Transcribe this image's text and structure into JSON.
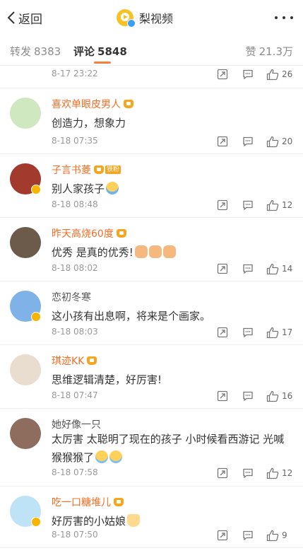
{
  "nav": {
    "back_label": "返回",
    "title": "梨视频",
    "logo_color": "#f6c224",
    "more_icon": "more-dots-icon"
  },
  "tabs": {
    "repost_label": "转发",
    "repost_count": "8383",
    "comment_label": "评论",
    "comment_count": "5848",
    "like_label": "赞",
    "like_count": "21.3万",
    "accent_color": "#fa7d3c"
  },
  "comments": [
    {
      "time": "8-17 23:22",
      "likes": "26"
    },
    {
      "name": "喜欢单眼皮男人",
      "vip": true,
      "verified": false,
      "text": "创造力，想象力",
      "emoji": [],
      "time": "8-18 07:35",
      "likes": "20",
      "avatar_color": "#cfe8c0"
    },
    {
      "name": "子言书菱",
      "vip": true,
      "fan_tag": "铁粉",
      "verified": true,
      "text": "别人家孩子",
      "emoji": [
        "cry"
      ],
      "time": "8-18 08:48",
      "likes": "12",
      "avatar_color": "#a33a2e"
    },
    {
      "name": "昨天高烧60度",
      "vip": true,
      "verified": false,
      "text": "优秀 是真的优秀!",
      "emoji": [
        "clap",
        "clap",
        "clap"
      ],
      "time": "8-18 08:02",
      "likes": "14",
      "avatar_color": "#6c5a4a"
    },
    {
      "name": "恋初冬寒",
      "vip": false,
      "verified": true,
      "text": "这小孩有出息啊，将来是个画家。",
      "emoji": [],
      "time": "8-18 08:03",
      "likes": "17",
      "avatar_color": "#7fb3e8"
    },
    {
      "name": "琪迹KK",
      "vip": true,
      "verified": false,
      "text": "思维逻辑清楚，好厉害!",
      "emoji": [],
      "time": "8-18 07:47",
      "likes": "16",
      "avatar_color": "#e9ddd0"
    },
    {
      "name": "她好像一只",
      "vip": false,
      "verified": false,
      "text": "太厉害 太聪明了现在的孩子 小时候看西游记 光喊猴猴猴了",
      "emoji": [
        "laugh",
        "laugh"
      ],
      "time": "8-18 07:58",
      "likes": "12",
      "avatar_color": "#8e6d5e"
    },
    {
      "name": "吃一口糖堆儿",
      "vip": true,
      "verified": true,
      "text": "好厉害的小姑娘",
      "emoji": [
        "girl"
      ],
      "time": "8-18 07:50",
      "likes": "9",
      "avatar_color": "#bfe3f6"
    }
  ]
}
